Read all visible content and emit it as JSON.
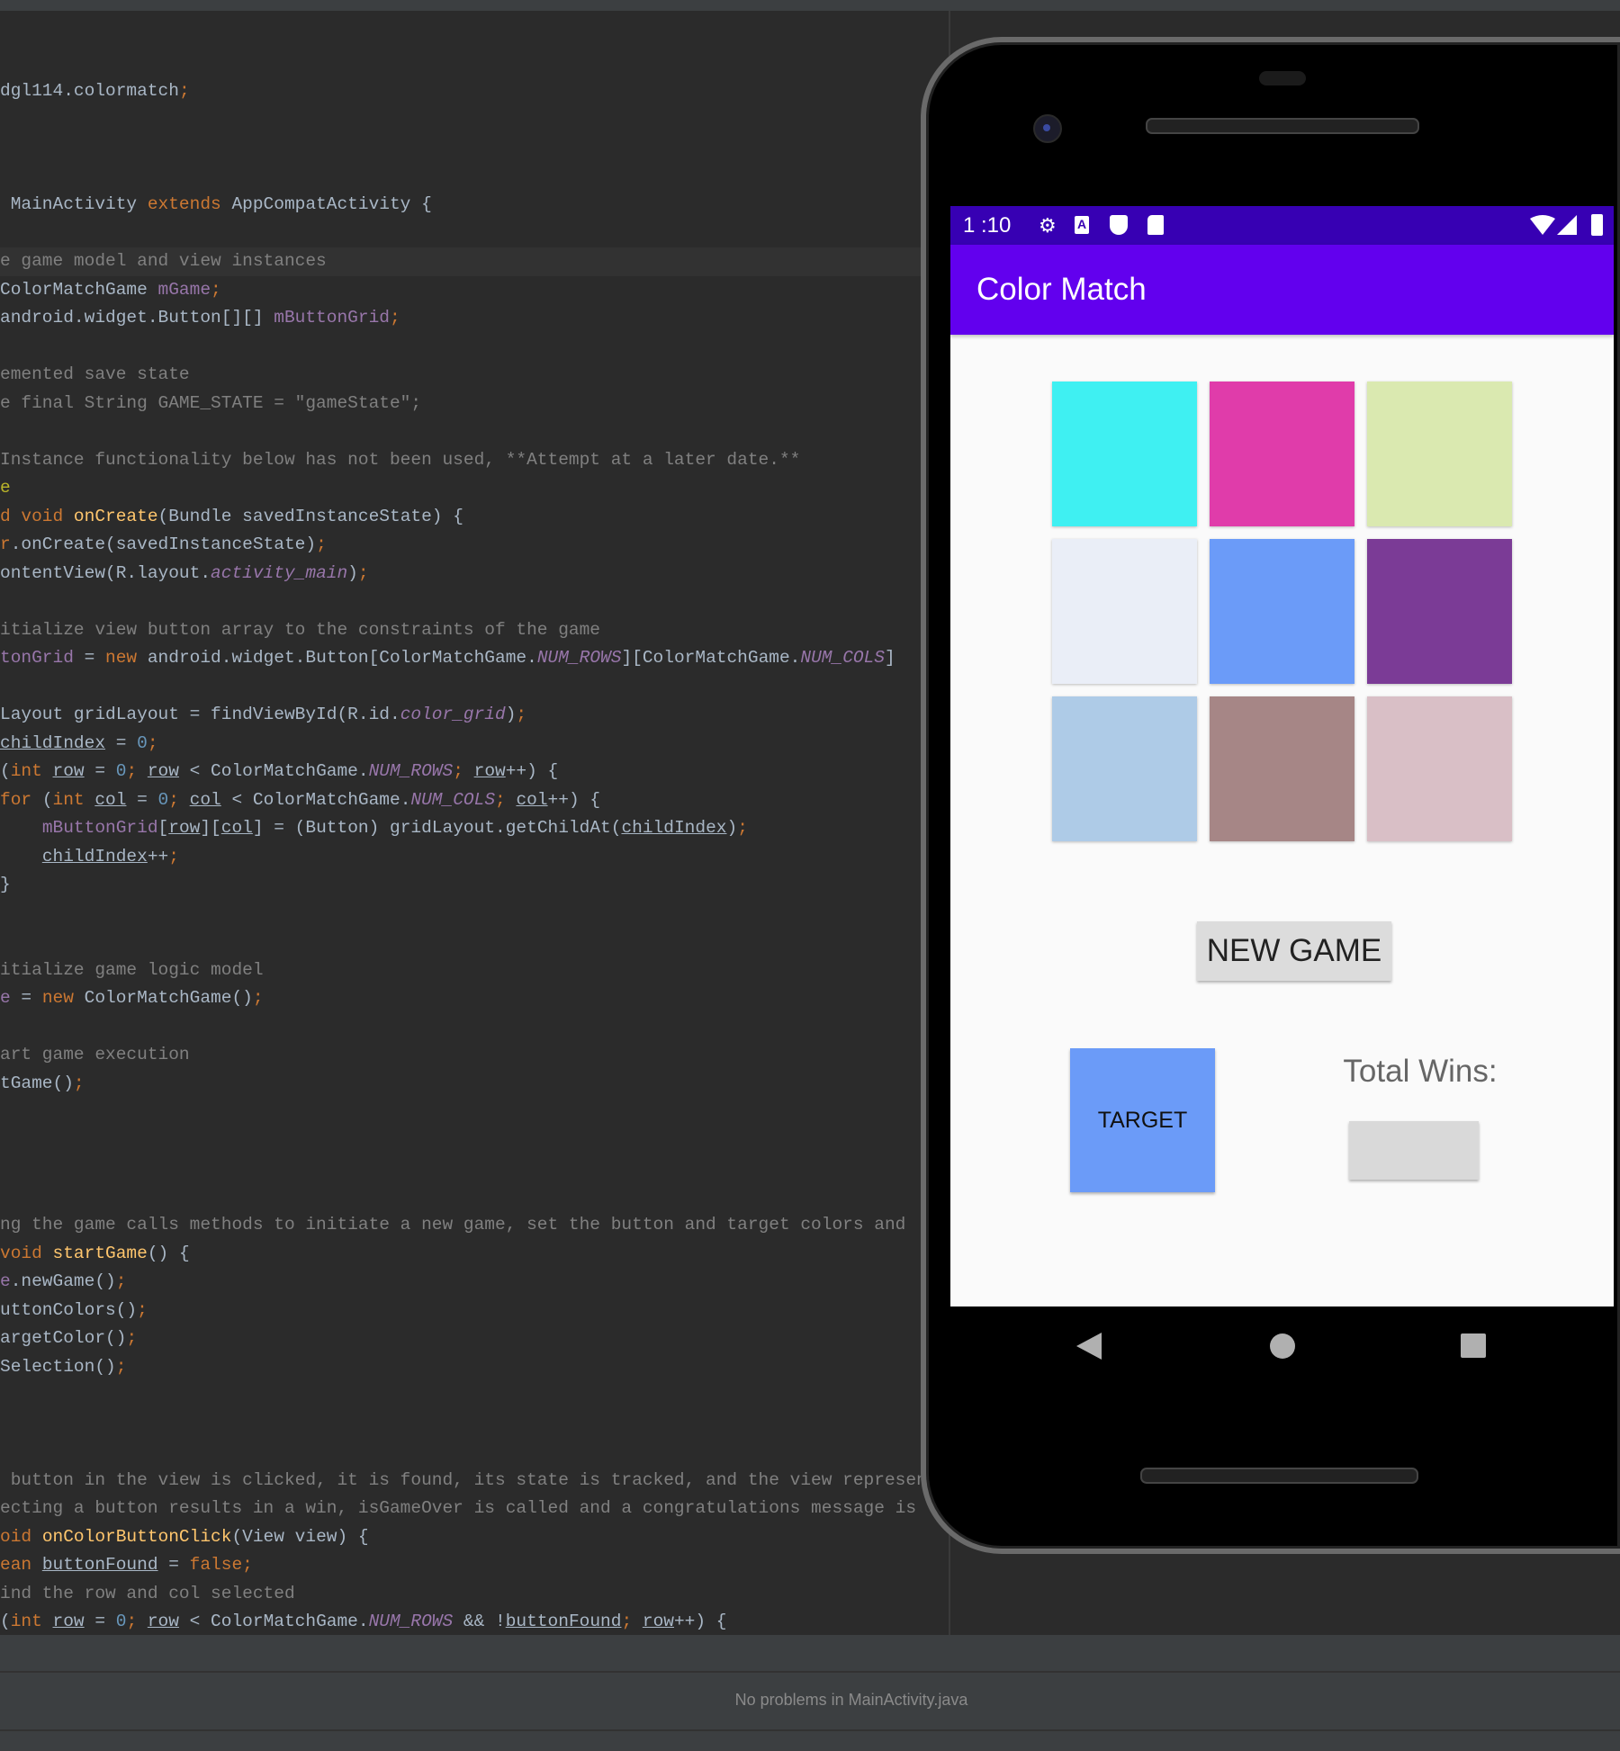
{
  "editor": {
    "lines": [
      [
        [
          "dgl114.colormatch",
          "t"
        ],
        [
          ";",
          "k"
        ]
      ],
      [],
      [],
      [],
      [
        [
          " MainActivity ",
          "t"
        ],
        [
          "extends",
          "k"
        ],
        [
          " AppCompatActivity {",
          "t"
        ]
      ],
      [],
      [
        [
          "e game model and view instances",
          "c"
        ]
      ],
      [
        [
          "ColorMatchGame ",
          "t"
        ],
        [
          "mGame",
          "p"
        ],
        [
          ";",
          "k"
        ]
      ],
      [
        [
          "android.widget.Button[][] ",
          "t"
        ],
        [
          "mButtonGrid",
          "p"
        ],
        [
          ";",
          "k"
        ]
      ],
      [],
      [
        [
          "emented save state",
          "c"
        ]
      ],
      [
        [
          "e final String GAME_STATE = \"gameState\";",
          "c"
        ]
      ],
      [],
      [
        [
          "Instance functionality below has not been used, **Attempt at a later date.**",
          "c"
        ]
      ],
      [
        [
          "e",
          "a"
        ]
      ],
      [
        [
          "d void ",
          "k"
        ],
        [
          "onCreate",
          "f"
        ],
        [
          "(Bundle savedInstanceState) {",
          "t"
        ]
      ],
      [
        [
          "r",
          "k"
        ],
        [
          ".onCreate(savedInstanceState)",
          "t"
        ],
        [
          ";",
          "k"
        ]
      ],
      [
        [
          "ontentView(R.layout.",
          "t"
        ],
        [
          "activity_main",
          "pi"
        ],
        [
          ")",
          "t"
        ],
        [
          ";",
          "k"
        ]
      ],
      [],
      [
        [
          "itialize view button array to the constraints of the game",
          "c"
        ]
      ],
      [
        [
          "tonGrid",
          "p"
        ],
        [
          " = ",
          "t"
        ],
        [
          "new",
          "k"
        ],
        [
          " android.widget.Button[ColorMatchGame.",
          "t"
        ],
        [
          "NUM_ROWS",
          "pi"
        ],
        [
          "][ColorMatchGame.",
          "t"
        ],
        [
          "NUM_COLS",
          "pi"
        ],
        [
          "]",
          "t"
        ]
      ],
      [],
      [
        [
          "Layout gridLayout = findViewById(R.id.",
          "t"
        ],
        [
          "color_grid",
          "pi"
        ],
        [
          ")",
          "t"
        ],
        [
          ";",
          "k"
        ]
      ],
      [
        [
          "childIndex",
          "u"
        ],
        [
          " = ",
          "t"
        ],
        [
          "0",
          "n"
        ],
        [
          ";",
          "k"
        ]
      ],
      [
        [
          "(",
          "t"
        ],
        [
          "int ",
          "k"
        ],
        [
          "row",
          "u"
        ],
        [
          " = ",
          "t"
        ],
        [
          "0",
          "n"
        ],
        [
          "; ",
          "k"
        ],
        [
          "row",
          "u"
        ],
        [
          " < ColorMatchGame.",
          "t"
        ],
        [
          "NUM_ROWS",
          "pi"
        ],
        [
          "; ",
          "k"
        ],
        [
          "row",
          "u"
        ],
        [
          "++) {",
          "t"
        ]
      ],
      [
        [
          "for ",
          "k"
        ],
        [
          "(",
          "t"
        ],
        [
          "int ",
          "k"
        ],
        [
          "col",
          "u"
        ],
        [
          " = ",
          "t"
        ],
        [
          "0",
          "n"
        ],
        [
          "; ",
          "k"
        ],
        [
          "col",
          "u"
        ],
        [
          " < ColorMatchGame.",
          "t"
        ],
        [
          "NUM_COLS",
          "pi"
        ],
        [
          "; ",
          "k"
        ],
        [
          "col",
          "u"
        ],
        [
          "++) {",
          "t"
        ]
      ],
      [
        [
          "    ",
          "t"
        ],
        [
          "mButtonGrid",
          "p"
        ],
        [
          "[",
          "t"
        ],
        [
          "row",
          "u"
        ],
        [
          "][",
          "t"
        ],
        [
          "col",
          "u"
        ],
        [
          "] = (Button) gridLayout.getChildAt(",
          "t"
        ],
        [
          "childIndex",
          "u"
        ],
        [
          ")",
          "t"
        ],
        [
          ";",
          "k"
        ]
      ],
      [
        [
          "    ",
          "t"
        ],
        [
          "childIndex",
          "u"
        ],
        [
          "++",
          "t"
        ],
        [
          ";",
          "k"
        ]
      ],
      [
        [
          "}",
          "t"
        ]
      ],
      [],
      [],
      [
        [
          "itialize game logic model",
          "c"
        ]
      ],
      [
        [
          "e",
          "p"
        ],
        [
          " = ",
          "t"
        ],
        [
          "new ",
          "k"
        ],
        [
          "ColorMatchGame()",
          "t"
        ],
        [
          ";",
          "k"
        ]
      ],
      [],
      [
        [
          "art game execution",
          "c"
        ]
      ],
      [
        [
          "tGame()",
          "t"
        ],
        [
          ";",
          "k"
        ]
      ],
      [],
      [],
      [],
      [],
      [
        [
          "ng the game calls methods to initiate a new game, set the button and target colors and",
          "c"
        ]
      ],
      [
        [
          "void ",
          "k"
        ],
        [
          "startGame",
          "f"
        ],
        [
          "() {",
          "t"
        ]
      ],
      [
        [
          "e",
          "p"
        ],
        [
          ".newGame()",
          "t"
        ],
        [
          ";",
          "k"
        ]
      ],
      [
        [
          "uttonColors()",
          "t"
        ],
        [
          ";",
          "k"
        ]
      ],
      [
        [
          "argetColor()",
          "t"
        ],
        [
          ";",
          "k"
        ]
      ],
      [
        [
          "Selection()",
          "t"
        ],
        [
          ";",
          "k"
        ]
      ],
      [],
      [],
      [],
      [
        [
          " button in the view is clicked, it is found, its state is tracked, and the view represents",
          "c"
        ]
      ],
      [
        [
          "ecting a button results in a win, isGameOver is called and a congratulations message is",
          "c"
        ]
      ],
      [
        [
          "oid ",
          "k"
        ],
        [
          "onColorButtonClick",
          "f"
        ],
        [
          "(View view) {",
          "t"
        ]
      ],
      [
        [
          "ean ",
          "k"
        ],
        [
          "buttonFound",
          "u"
        ],
        [
          " = ",
          "t"
        ],
        [
          "false",
          "k"
        ],
        [
          ";",
          "k"
        ]
      ],
      [
        [
          "ind the row and col selected",
          "c"
        ]
      ],
      [
        [
          "(",
          "t"
        ],
        [
          "int ",
          "k"
        ],
        [
          "row",
          "u"
        ],
        [
          " = ",
          "t"
        ],
        [
          "0",
          "n"
        ],
        [
          "; ",
          "k"
        ],
        [
          "row",
          "u"
        ],
        [
          " < ColorMatchGame.",
          "t"
        ],
        [
          "NUM_ROWS",
          "pi"
        ],
        [
          " && !",
          "t"
        ],
        [
          "buttonFound",
          "u"
        ],
        [
          "; ",
          "k"
        ],
        [
          "row",
          "u"
        ],
        [
          "++) {",
          "t"
        ]
      ]
    ],
    "highlighted_line": 6
  },
  "problems_panel": {
    "message": "No problems in MainActivity.java"
  },
  "phone": {
    "status_bar": {
      "time": "1 :10",
      "icons": [
        "gear-icon",
        "a-badge-icon",
        "shield-play-icon",
        "sd-card-icon"
      ],
      "right_icons": [
        "wifi-icon",
        "signal-icon",
        "battery-icon"
      ],
      "color": "#3700B3"
    },
    "app_bar": {
      "title": "Color Match",
      "color": "#6200EE"
    },
    "grid_colors": [
      "#3FF0F2",
      "#E03CAA",
      "#DAE9B0",
      "#EAEEF7",
      "#6B9BF8",
      "#7B3B96",
      "#AECBE7",
      "#A68686",
      "#D9BFC6"
    ],
    "new_game_label": "NEW GAME",
    "target": {
      "label": "TARGET",
      "color": "#6B9BF8"
    },
    "total_wins_label": "Total Wins:",
    "total_wins_value": ""
  }
}
